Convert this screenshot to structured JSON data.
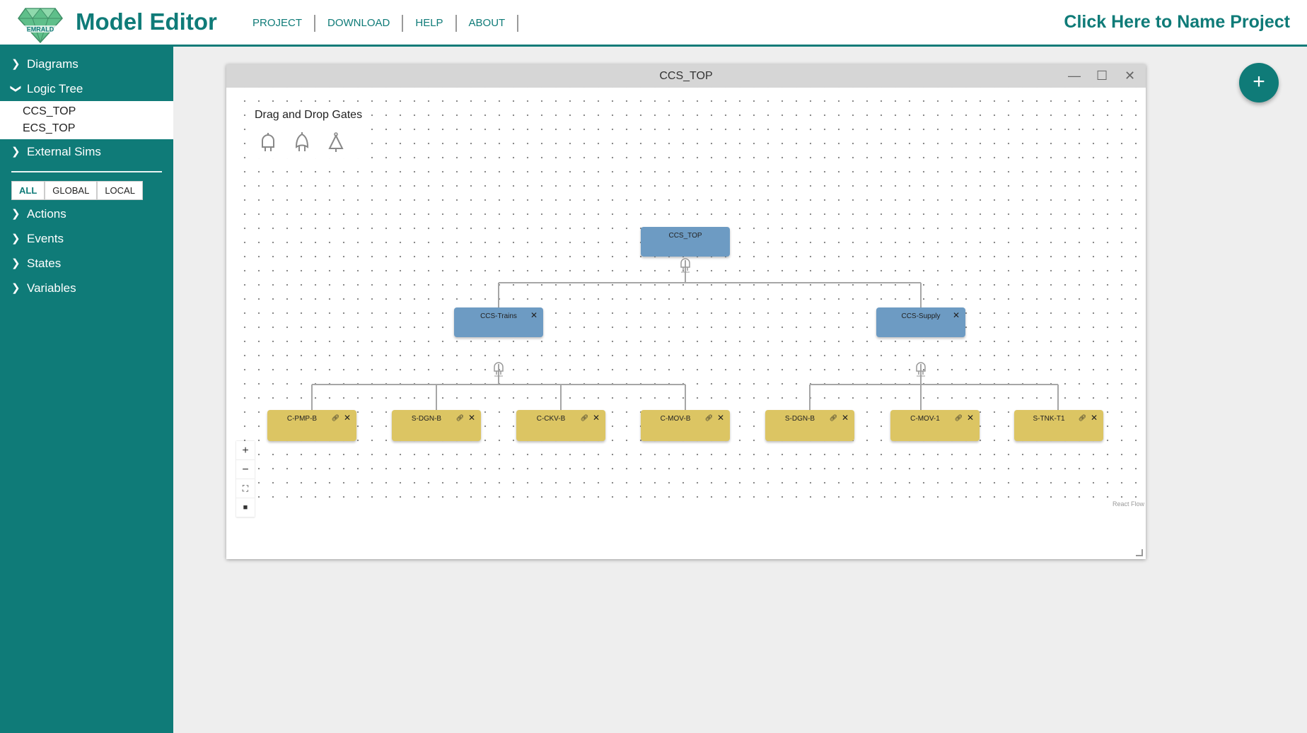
{
  "header": {
    "logo_text": "EMRALD",
    "title": "Model Editor",
    "nav": [
      "PROJECT",
      "DOWNLOAD",
      "HELP",
      "ABOUT"
    ],
    "project_name": "Click Here to Name Project"
  },
  "sidebar": {
    "sections": {
      "diagrams": "Diagrams",
      "logic_tree": "Logic Tree",
      "external_sims": "External Sims",
      "actions": "Actions",
      "events": "Events",
      "states": "States",
      "variables": "Variables"
    },
    "logic_tree_items": [
      "CCS_TOP",
      "ECS_TOP"
    ],
    "scope_filters": [
      "ALL",
      "GLOBAL",
      "LOCAL"
    ],
    "active_scope": "ALL"
  },
  "window": {
    "title": "CCS_TOP",
    "palette_title": "Drag and Drop Gates",
    "palette_icons": [
      "and-gate-icon",
      "or-gate-icon",
      "not-gate-icon"
    ],
    "attribution": "React Flow"
  },
  "tree": {
    "root": "CCS_TOP",
    "gates": [
      "CCS-Trains",
      "CCS-Supply"
    ],
    "events": [
      "C-PMP-B",
      "S-DGN-B",
      "C-CKV-B",
      "C-MOV-B",
      "S-DGN-B",
      "C-MOV-1",
      "S-TNK-T1"
    ]
  },
  "colors": {
    "accent": "#0f7b78",
    "gate_node": "#6d9bc3",
    "event_node": "#dcc563"
  }
}
